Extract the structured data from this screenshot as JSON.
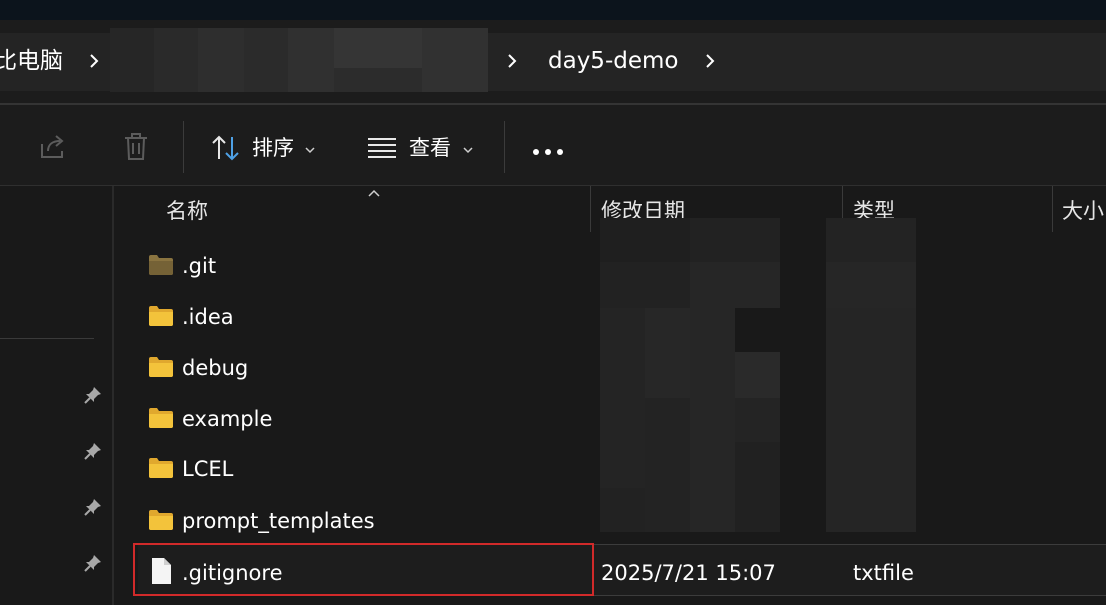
{
  "address_bar": {
    "crumbs": [
      "此电脑",
      "day5-demo"
    ],
    "crumb_visible": [
      "比电脑",
      "day5-demo"
    ]
  },
  "toolbar": {
    "share_icon": "share-icon",
    "delete_icon": "trash-icon",
    "sort_label": "排序",
    "view_label": "查看",
    "more_icon": "more-icon"
  },
  "columns": {
    "name": "名称",
    "date_modified": "修改日期",
    "type": "类型",
    "size": "大小"
  },
  "files": [
    {
      "name": ".git",
      "kind": "folder"
    },
    {
      "name": ".idea",
      "kind": "folder"
    },
    {
      "name": "debug",
      "kind": "folder"
    },
    {
      "name": "example",
      "kind": "folder"
    },
    {
      "name": "LCEL",
      "kind": "folder"
    },
    {
      "name": "prompt_templates",
      "kind": "folder"
    }
  ],
  "selected_file": {
    "name": ".gitignore",
    "date_modified": "2025/7/21 15:07",
    "type": "txtfile"
  },
  "colors": {
    "background": "#191919",
    "folder_yellow": "#f3c33b",
    "git_folder": "#8a7440",
    "highlight_border": "#d12a2a"
  }
}
